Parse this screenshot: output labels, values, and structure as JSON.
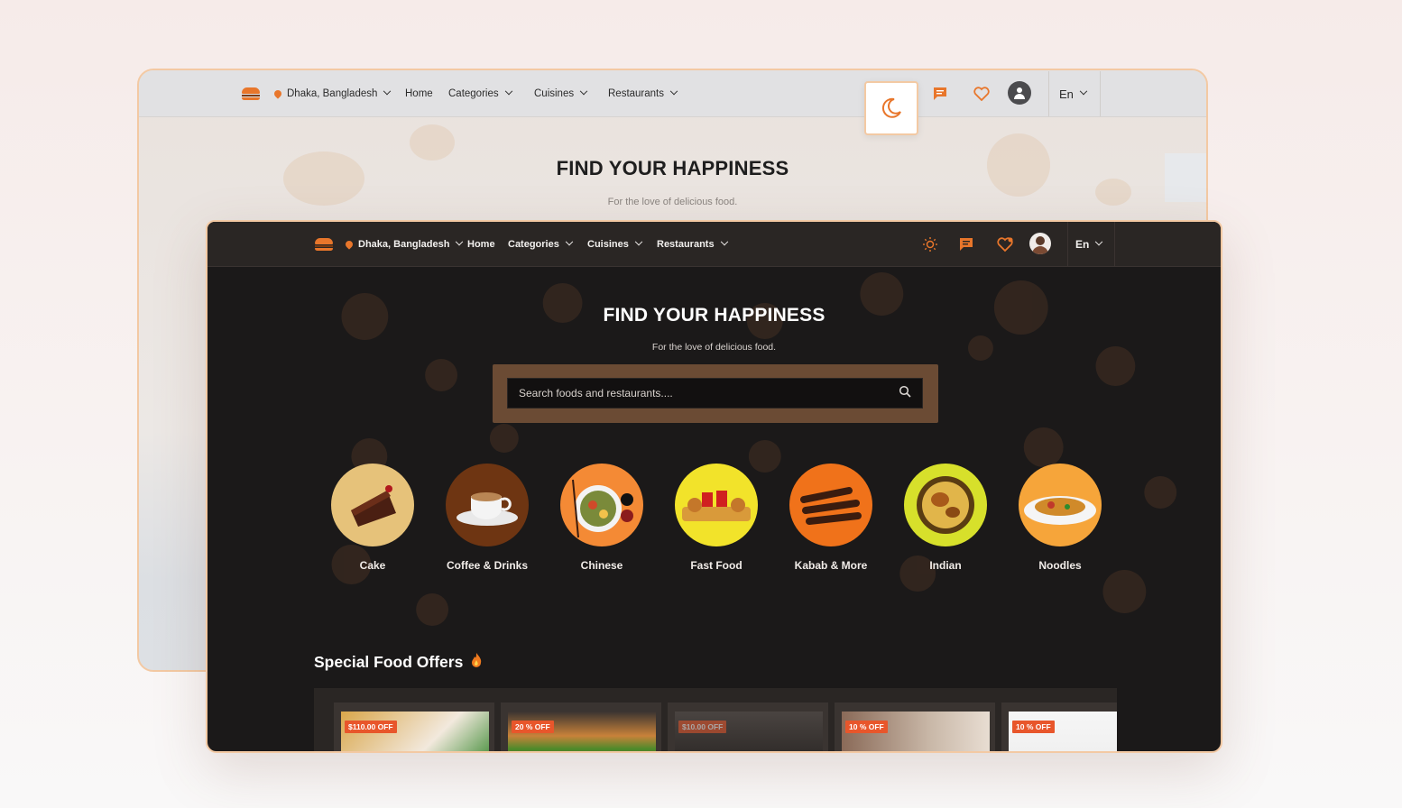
{
  "light": {
    "location": "Dhaka, Bangladesh",
    "nav": {
      "home": "Home",
      "categories": "Categories",
      "cuisines": "Cuisines",
      "restaurants": "Restaurants"
    },
    "lang": "En",
    "hero_title": "FIND YOUR HAPPINESS",
    "hero_sub": "For the love of delicious food."
  },
  "dark": {
    "location": "Dhaka, Bangladesh",
    "nav": {
      "home": "Home",
      "categories": "Categories",
      "cuisines": "Cuisines",
      "restaurants": "Restaurants"
    },
    "lang": "En",
    "hero_title": "FIND YOUR HAPPINESS",
    "hero_sub": "For the love of delicious food.",
    "search_placeholder": "Search foods and restaurants....",
    "categories": [
      {
        "label": "Cake",
        "color": "#e6c27a"
      },
      {
        "label": "Coffee & Drinks",
        "color": "#6e3512"
      },
      {
        "label": "Chinese",
        "color": "#f48a35"
      },
      {
        "label": "Fast Food",
        "color": "#f2e32a"
      },
      {
        "label": "Kabab & More",
        "color": "#f0721a"
      },
      {
        "label": "Indian",
        "color": "#d7e02b"
      },
      {
        "label": "Noodles",
        "color": "#f6a53a"
      }
    ],
    "offers_title": "Special Food Offers",
    "offers": [
      {
        "badge": "$110.00 OFF"
      },
      {
        "badge": "20 % OFF"
      },
      {
        "badge": "$10.00 OFF"
      },
      {
        "badge": "10 % OFF"
      },
      {
        "badge": "10 % OFF"
      }
    ]
  },
  "colors": {
    "accent": "#e8762b",
    "dark_bg": "#1b1919",
    "border": "#f3c9a3"
  }
}
